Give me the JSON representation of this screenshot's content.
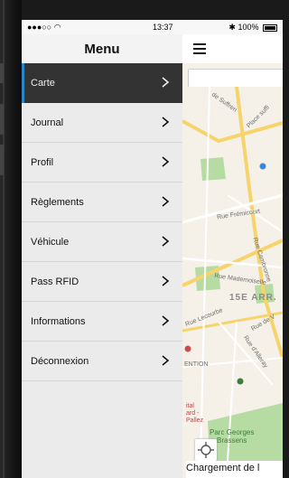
{
  "status_bar": {
    "signal": "●●●○○",
    "time": "13:37",
    "bluetooth": "✱",
    "battery": "100%"
  },
  "drawer": {
    "title": "Menu",
    "items": [
      {
        "label": "Carte",
        "active": true
      },
      {
        "label": "Journal",
        "active": false
      },
      {
        "label": "Profil",
        "active": false
      },
      {
        "label": "Règlements",
        "active": false
      },
      {
        "label": "Véhicule",
        "active": false
      },
      {
        "label": "Pass RFID",
        "active": false
      },
      {
        "label": "Informations",
        "active": false
      },
      {
        "label": "Déconnexion",
        "active": false
      }
    ]
  },
  "map": {
    "labels": {
      "suffren": "de Suffren",
      "place": "Place suffi",
      "fremicourt": "Rue Frémicourt",
      "cambronne": "Rue Cambronne",
      "mademoiselle": "Rue Mademoiselle",
      "arr": "15E ARR.",
      "lecourbe": "Rue Lecourbe",
      "rue_de": "Rue de V",
      "dalleray": "Rue d'Alleray",
      "vention": "ENTION",
      "hospital": "ital\nard -\nPallez",
      "park": "Parc Georges\nBrassens"
    },
    "loading_text": "Chargement de l"
  },
  "colors": {
    "drawer_bg": "#ebebeb",
    "active_bg": "#333333",
    "active_accent": "#2a86c7",
    "map_bg": "#f5f1e8",
    "road": "#f6d46b",
    "park": "#b7dca3"
  }
}
